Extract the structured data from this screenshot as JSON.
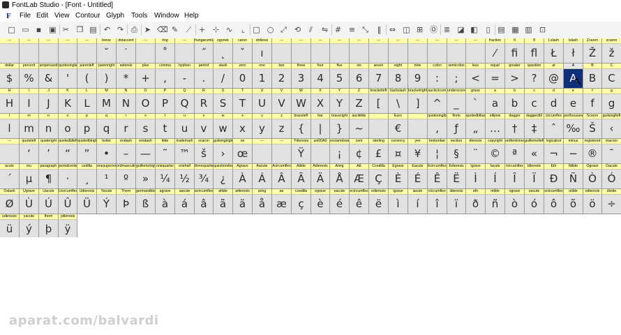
{
  "window": {
    "title": "FontLab Studio - [Font - Untitled]"
  },
  "menu": {
    "items": [
      "File",
      "Edit",
      "View",
      "Contour",
      "Glyph",
      "Tools",
      "Window",
      "Help"
    ],
    "logo": "F"
  },
  "toolbar": {
    "icons": [
      "new-icon",
      "open-icon",
      "save-icon",
      "save-all-icon",
      "cut-icon",
      "copy-icon",
      "paste-icon",
      "undo-icon",
      "redo-icon",
      "print-icon",
      "pointer-icon",
      "eraser-icon",
      "pen-icon",
      "knife-icon",
      "node-icon",
      "tangent-icon",
      "curve-icon",
      "corner-icon",
      "rectangle-icon",
      "ellipse-icon",
      "scale-icon",
      "rotate-icon",
      "slant-icon",
      "mirror-icon",
      "grid-icon",
      "align-icon",
      "transform-icon",
      "metrics-icon",
      "kerning-icon",
      "class-icon",
      "hint-icon",
      "ot-icon",
      "layer-icon",
      "mask-icon",
      "mode-icon",
      "view-icon",
      "book-icon",
      "preview-icon",
      "split-icon",
      "zoom-icon"
    ]
  },
  "font_grid": {
    "selected_glyph": "A",
    "rows": [
      {
        "names": [
          "---",
          "---",
          "---",
          "---",
          "---",
          "breve",
          "dotaccent",
          "---",
          "ring",
          "---",
          "hungarumlaut",
          "ogonek",
          "caron",
          "dotlessi",
          "---",
          "---",
          "---",
          "---",
          "---",
          "---",
          "---",
          "---",
          "---",
          "---",
          "---",
          "fraction",
          "fi",
          "fl",
          "Lslash",
          "lslash",
          "Zcaron",
          "zcaron"
        ],
        "chars": [
          "",
          "",
          "",
          "",
          "",
          "˘",
          "˙",
          "",
          "˚",
          "",
          "˝",
          "˛",
          "ˇ",
          "ı",
          "",
          "",
          "",
          "",
          "",
          "",
          "",
          "",
          "",
          "",
          "",
          "⁄",
          "ﬁ",
          "ﬂ",
          "Ł",
          "ł",
          "Ž",
          "ž"
        ]
      },
      {
        "names": [
          "dollar",
          "percent",
          "ampersand",
          "quotesingle",
          "parenleft",
          "parenright",
          "asterisk",
          "plus",
          "comma",
          "hyphen",
          "period",
          "slash",
          "zero",
          "one",
          "two",
          "three",
          "four",
          "five",
          "six",
          "seven",
          "eight",
          "nine",
          "colon",
          "semicolon",
          "less",
          "equal",
          "greater",
          "question",
          "at",
          "A",
          "B",
          "C"
        ],
        "chars": [
          "$",
          "%",
          "&",
          "'",
          "(",
          ")",
          "*",
          "+",
          ",",
          "-",
          ".",
          "/",
          "0",
          "1",
          "2",
          "3",
          "4",
          "5",
          "6",
          "7",
          "8",
          "9",
          ":",
          ";",
          "<",
          "=",
          ">",
          "?",
          "@",
          "A",
          "B",
          "C"
        ]
      },
      {
        "names": [
          "H",
          "I",
          "J",
          "K",
          "L",
          "M",
          "N",
          "O",
          "P",
          "Q",
          "R",
          "S",
          "T",
          "U",
          "V",
          "W",
          "X",
          "Y",
          "Z",
          "bracketleft",
          "backslash",
          "bracketright",
          "asciicircum",
          "underscore",
          "grave",
          "a",
          "b",
          "c",
          "d",
          "e",
          "f",
          "g"
        ],
        "chars": [
          "H",
          "I",
          "J",
          "K",
          "L",
          "M",
          "N",
          "O",
          "P",
          "Q",
          "R",
          "S",
          "T",
          "U",
          "V",
          "W",
          "X",
          "Y",
          "Z",
          "[",
          "\\",
          "]",
          "^",
          "_",
          "`",
          "a",
          "b",
          "c",
          "d",
          "e",
          "f",
          "g"
        ]
      },
      {
        "names": [
          "l",
          "m",
          "n",
          "o",
          "p",
          "q",
          "r",
          "s",
          "t",
          "u",
          "v",
          "w",
          "x",
          "y",
          "z",
          "braceleft",
          "bar",
          "braceright",
          "asciitilde",
          "",
          "Euro",
          "",
          "quotesinglbase",
          "florin",
          "quotedblbase",
          "ellipsis",
          "dagger",
          "daggerdbl",
          "circumflex",
          "perthousand",
          "Scaron",
          "guilsinglleft"
        ],
        "chars": [
          "l",
          "m",
          "n",
          "o",
          "p",
          "q",
          "r",
          "s",
          "t",
          "u",
          "v",
          "w",
          "x",
          "y",
          "z",
          "{",
          "|",
          "}",
          "~",
          "",
          "€",
          "",
          "‚",
          "ƒ",
          "„",
          "…",
          "†",
          "‡",
          "ˆ",
          "‰",
          "Š",
          "‹"
        ]
      },
      {
        "names": [
          "---",
          "quoteleft",
          "quoteright",
          "quotedblleft",
          "quotedblright",
          "bullet",
          "endash",
          "emdash",
          "tilde",
          "trademark",
          "scaron",
          "guilsinglright",
          "oe",
          "---",
          "---",
          "Ydieresis",
          "uni00A0",
          "exclamdown",
          "cent",
          "sterling",
          "currency",
          "yen",
          "brokenbar",
          "section",
          "dieresis",
          "copyright",
          "ordfeminine",
          "guillemotleft",
          "logicalnot",
          "minus",
          "registered",
          "macron"
        ],
        "chars": [
          "",
          "‘",
          "’",
          "“",
          "”",
          "•",
          "–",
          "—",
          "˜",
          "™",
          "š",
          "›",
          "œ",
          "",
          "",
          "Ÿ",
          "",
          "¡",
          "¢",
          "£",
          "¤",
          "¥",
          "¦",
          "§",
          "¨",
          "©",
          "ª",
          "«",
          "¬",
          "−",
          "®",
          "¯"
        ]
      },
      {
        "names": [
          "acute",
          "mu",
          "paragraph",
          "periodcentered",
          "cedilla",
          "onesuperior",
          "ordmasculine",
          "guillemotright",
          "onequarter",
          "onehalf",
          "threequarters",
          "questiondown",
          "Agrave",
          "Aacute",
          "Acircumflex",
          "Atilde",
          "Adieresis",
          "Aring",
          "AE",
          "Ccedilla",
          "Egrave",
          "Eacute",
          "Ecircumflex",
          "Edieresis",
          "Igrave",
          "Iacute",
          "Icircumflex",
          "Idieresis",
          "Eth",
          "Ntilde",
          "Ograve",
          "Oacute"
        ],
        "chars": [
          "´",
          "µ",
          "¶",
          "·",
          "¸",
          "¹",
          "º",
          "»",
          "¼",
          "½",
          "¾",
          "¿",
          "À",
          "Á",
          "Â",
          "Ã",
          "Ä",
          "Å",
          "Æ",
          "Ç",
          "È",
          "É",
          "Ê",
          "Ë",
          "Ì",
          "Í",
          "Î",
          "Ï",
          "Ð",
          "Ñ",
          "Ò",
          "Ó"
        ]
      },
      {
        "names": [
          "Oslash",
          "Ugrave",
          "Uacute",
          "Ucircumflex",
          "Udieresis",
          "Yacute",
          "Thorn",
          "germandbls",
          "agrave",
          "aacute",
          "acircumflex",
          "atilde",
          "adieresis",
          "aring",
          "ae",
          "ccedilla",
          "egrave",
          "eacute",
          "ecircumflex",
          "edieresis",
          "igrave",
          "iacute",
          "icircumflex",
          "idieresis",
          "eth",
          "ntilde",
          "ograve",
          "oacute",
          "ocircumflex",
          "otilde",
          "odieresis",
          "divide"
        ],
        "chars": [
          "Ø",
          "Ù",
          "Ú",
          "Û",
          "Ü",
          "Ý",
          "Þ",
          "ß",
          "à",
          "á",
          "â",
          "ã",
          "ä",
          "å",
          "æ",
          "ç",
          "è",
          "é",
          "ê",
          "ë",
          "ì",
          "í",
          "î",
          "ï",
          "ð",
          "ñ",
          "ò",
          "ó",
          "ô",
          "õ",
          "ö",
          "÷"
        ]
      },
      {
        "names": [
          "udieresis",
          "yacute",
          "thorn",
          "ydieresis"
        ],
        "chars": [
          "ü",
          "ý",
          "þ",
          "ÿ"
        ]
      }
    ]
  },
  "watermark": "aparat.com/balvardi"
}
